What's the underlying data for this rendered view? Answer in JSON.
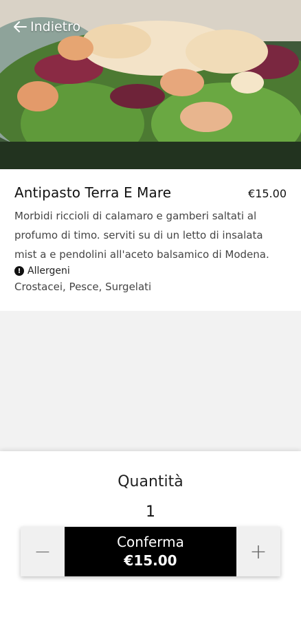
{
  "header": {
    "back_label": "Indietro"
  },
  "product": {
    "name": "Antipasto Terra E Mare",
    "price": "€15.00",
    "description": "Morbidi riccioli di calamaro e gamberi saltati al profumo di timo. serviti su di un letto di insalata mist a e pendolini all'aceto balsamico di Modena.",
    "allergen_heading": "Allergeni",
    "allergens": "Crostacei, Pesce, Surgelati"
  },
  "order": {
    "quantity_label": "Quantità",
    "quantity": "1",
    "decrement": "−",
    "increment": "+",
    "confirm_label": "Conferma",
    "confirm_price": "€15.00"
  },
  "icons": {
    "back": "arrow-left-icon",
    "allergen": "info-icon"
  }
}
